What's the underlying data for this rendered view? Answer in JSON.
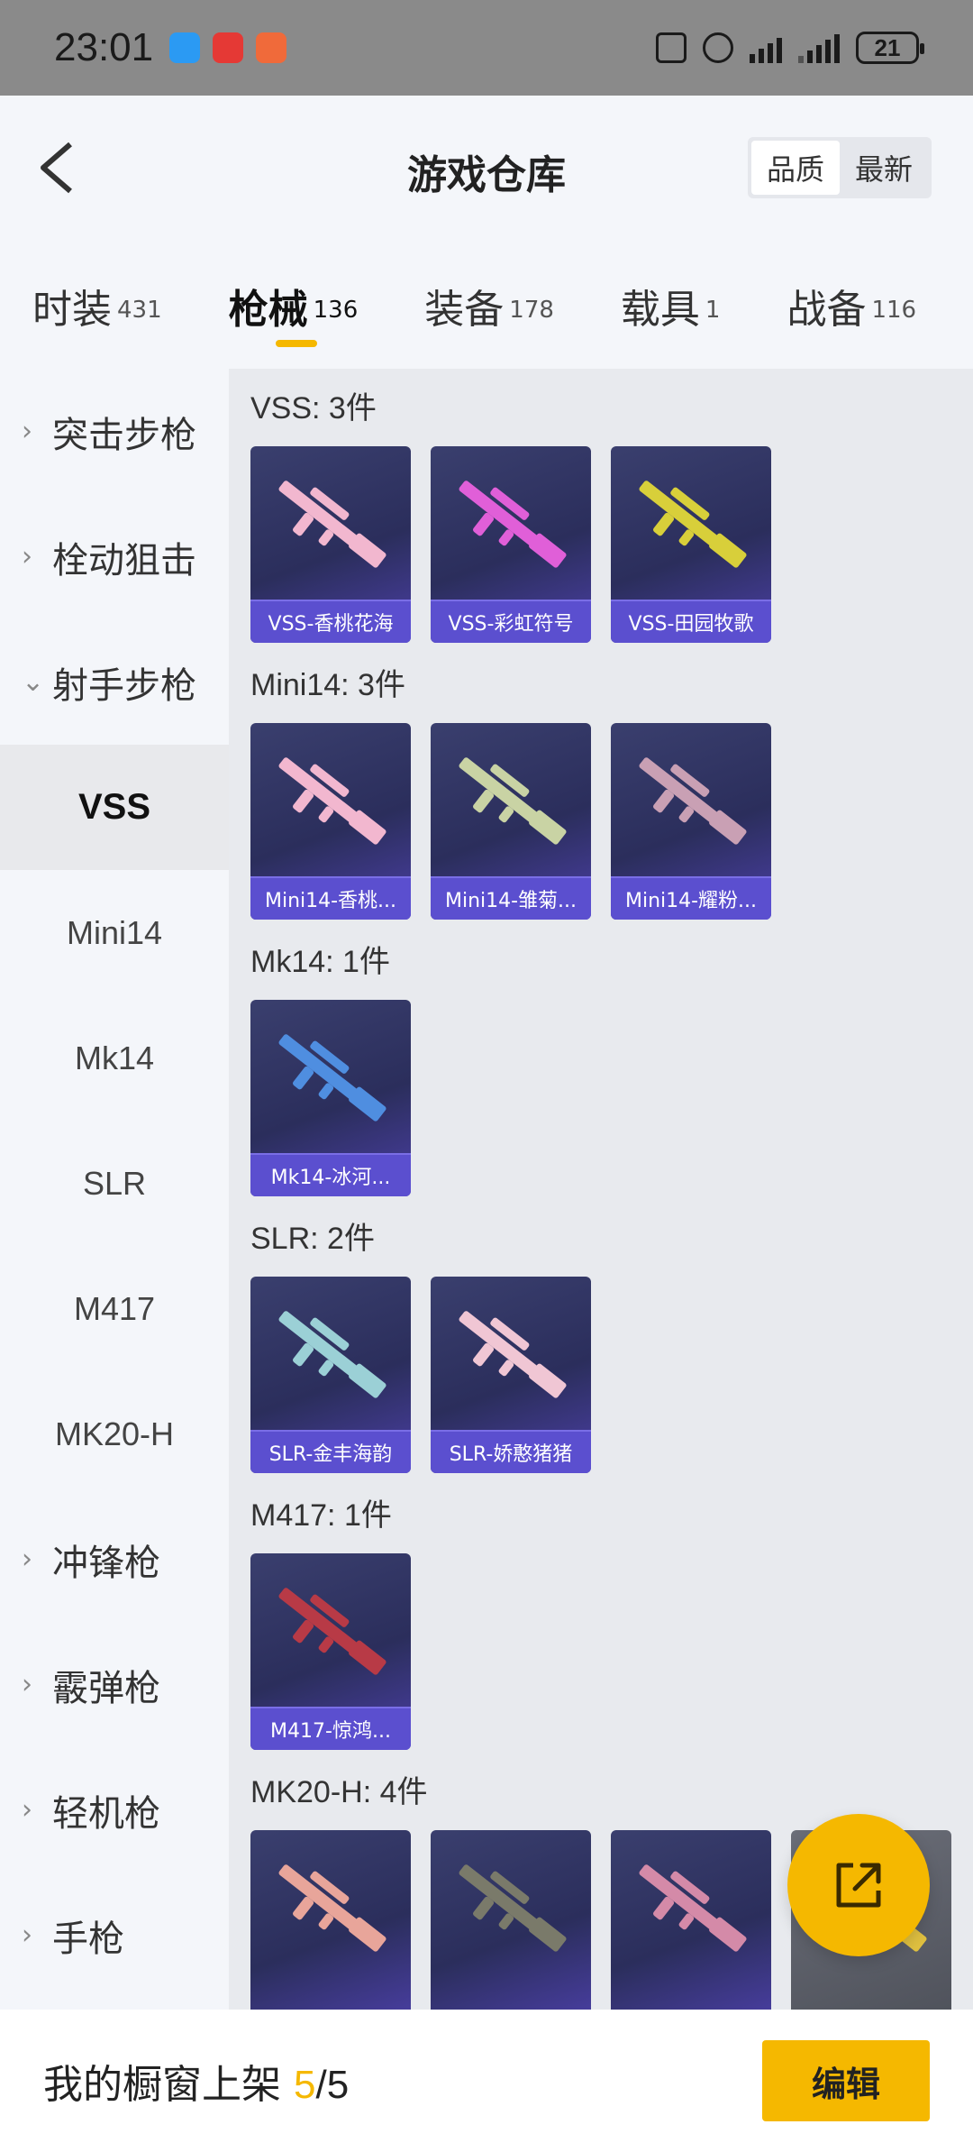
{
  "status_bar": {
    "time": "23:01",
    "battery": "21"
  },
  "header": {
    "title": "游戏仓库",
    "sort_options": [
      "品质",
      "最新"
    ],
    "active_sort": "品质"
  },
  "tabs": [
    {
      "label": "时装",
      "count": "431"
    },
    {
      "label": "枪械",
      "count": "136",
      "active": true
    },
    {
      "label": "装备",
      "count": "178"
    },
    {
      "label": "载具",
      "count": "1"
    },
    {
      "label": "战备",
      "count": "116"
    }
  ],
  "sidebar": {
    "items": [
      {
        "label": "突击步枪",
        "type": "group",
        "arrow": "›"
      },
      {
        "label": "栓动狙击",
        "type": "group",
        "arrow": "›"
      },
      {
        "label": "射手步枪",
        "type": "group",
        "arrow": "⌄",
        "expanded": true
      },
      {
        "label": "VSS",
        "type": "sub",
        "active": true
      },
      {
        "label": "Mini14",
        "type": "sub"
      },
      {
        "label": "Mk14",
        "type": "sub"
      },
      {
        "label": "SLR",
        "type": "sub"
      },
      {
        "label": "M417",
        "type": "sub"
      },
      {
        "label": "MK20-H",
        "type": "sub"
      },
      {
        "label": "冲锋枪",
        "type": "group",
        "arrow": "›"
      },
      {
        "label": "霰弹枪",
        "type": "group",
        "arrow": "›"
      },
      {
        "label": "轻机枪",
        "type": "group",
        "arrow": "›"
      },
      {
        "label": "手枪",
        "type": "group",
        "arrow": "›"
      }
    ]
  },
  "sections": [
    {
      "title": "VSS: 3件",
      "items": [
        {
          "name": "VSS-香桃花海",
          "color": "#f2b7cf"
        },
        {
          "name": "VSS-彩虹符号",
          "color": "#e05fd8"
        },
        {
          "name": "VSS-田园牧歌",
          "color": "#d8cf3a"
        }
      ]
    },
    {
      "title": "Mini14: 3件",
      "items": [
        {
          "name": "Mini14-香桃...",
          "color": "#f2b7cf"
        },
        {
          "name": "Mini14-雏菊...",
          "color": "#c9d3a4"
        },
        {
          "name": "Mini14-耀粉...",
          "color": "#c9a0b4"
        }
      ]
    },
    {
      "title": "Mk14: 1件",
      "items": [
        {
          "name": "Mk14-冰河...",
          "color": "#4f8ee0"
        }
      ]
    },
    {
      "title": "SLR: 2件",
      "items": [
        {
          "name": "SLR-金丰海韵",
          "color": "#9bd0d6"
        },
        {
          "name": "SLR-娇憨猪猪",
          "color": "#f0c6d4"
        }
      ]
    },
    {
      "title": "M417: 1件",
      "items": [
        {
          "name": "M417-惊鸿...",
          "color": "#b83a46"
        }
      ]
    },
    {
      "title": "MK20-H: 4件",
      "items": [
        {
          "name": "",
          "color": "#e8a59a"
        },
        {
          "name": "",
          "color": "#7a7a6a"
        },
        {
          "name": "",
          "color": "#d48aa8"
        },
        {
          "name": "",
          "color": "#e0c040"
        }
      ]
    }
  ],
  "bottom_bar": {
    "showcase_label": "我的橱窗上架",
    "showcase_current": "5",
    "showcase_sep": "/",
    "showcase_total": "5",
    "edit_label": "编辑"
  },
  "colors": {
    "accent": "#f5b800",
    "card_label": "#5b4fcf"
  }
}
